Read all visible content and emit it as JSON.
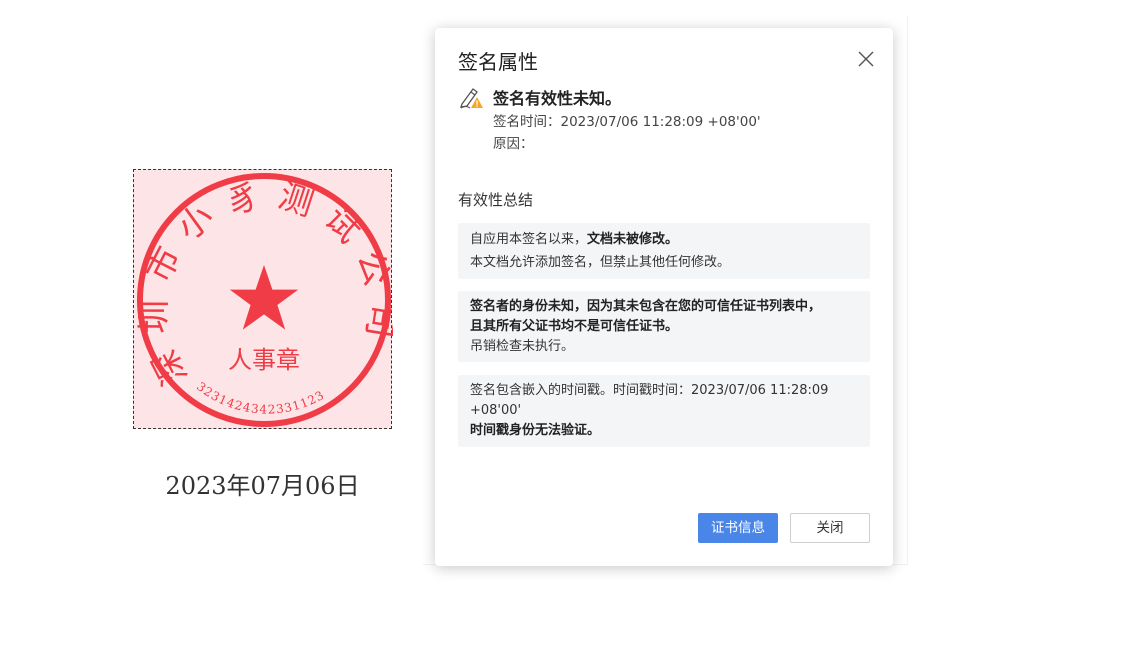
{
  "stamp": {
    "company_name": "深圳市小豸测试公司",
    "department": "人事章",
    "serial": "3231424342331123",
    "date": "2023年07月06日",
    "color": "#f03c46"
  },
  "dialog": {
    "title": "签名属性",
    "close_icon": "close-icon",
    "status": {
      "icon": "signature-warning-icon",
      "title": "签名有效性未知。",
      "time": "签名时间：2023/07/06 11:28:09 +08'00'",
      "reason": "原因："
    },
    "summary_title": "有效性总结",
    "cards": [
      {
        "line1_normal": "自应用本签名以来，",
        "line1_bold": "文档未被修改。",
        "line2": "本文档允许添加签名，但禁止其他任何修改。"
      },
      {
        "bold1": "签名者的身份未知，因为其未包含在您的可信任证书列表中，",
        "bold2": "且其所有父证书均不是可信任证书。",
        "normal": "吊销检查未执行。"
      },
      {
        "normal": "签名包含嵌入的时间戳。时间戳时间：2023/07/06 11:28:09 +08'00'",
        "bold": "时间戳身份无法验证。"
      }
    ],
    "buttons": {
      "cert_info": "证书信息",
      "close": "关闭"
    },
    "accent_color": "#4a86e8",
    "warning_color": "#f5a623"
  }
}
